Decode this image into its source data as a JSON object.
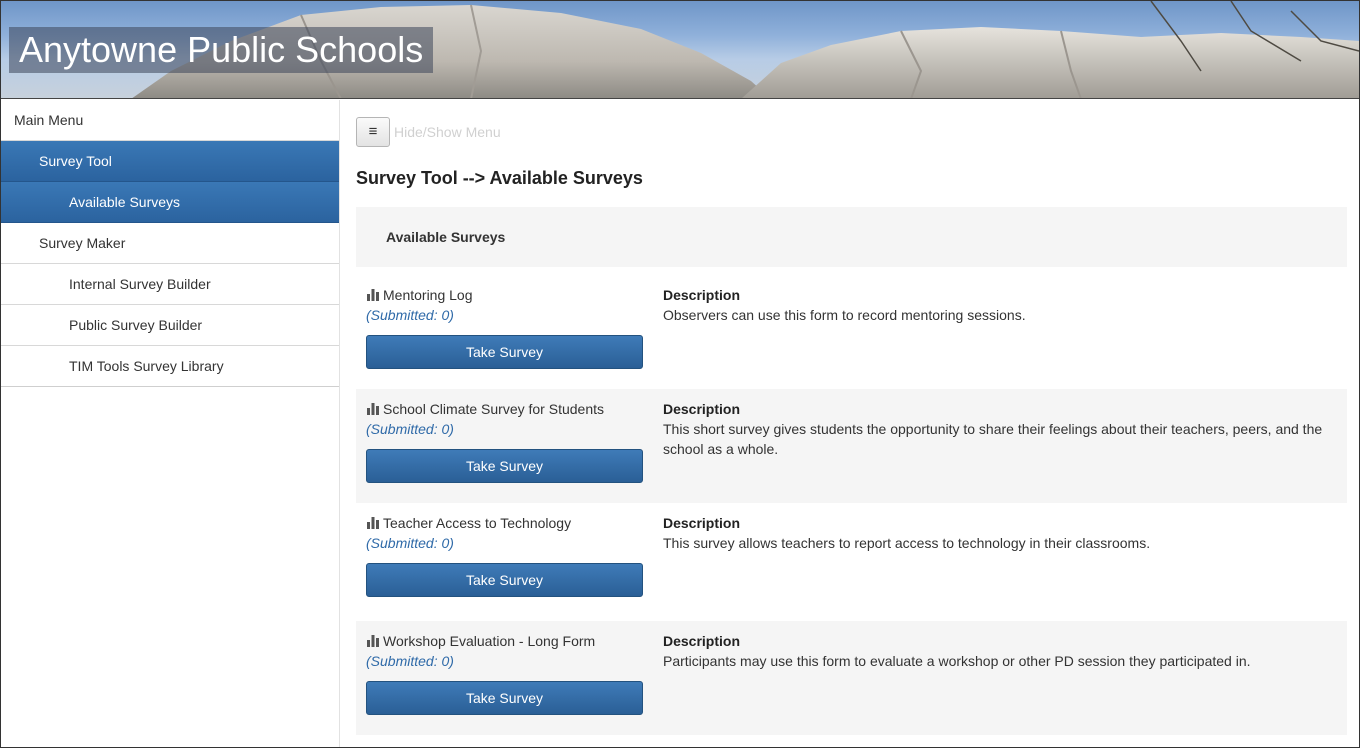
{
  "header": {
    "title": "Anytowne Public Schools"
  },
  "sidebar": {
    "items": [
      {
        "label": "Main Menu"
      },
      {
        "label": "Survey Tool"
      },
      {
        "label": "Available Surveys"
      },
      {
        "label": "Survey Maker"
      },
      {
        "label": "Internal Survey Builder"
      },
      {
        "label": "Public Survey Builder"
      },
      {
        "label": "TIM Tools Survey Library"
      }
    ]
  },
  "toolbar": {
    "toggle_icon": "≡",
    "toggle_label": "Hide/Show Menu"
  },
  "main": {
    "page_title": "Survey Tool --> Available Surveys",
    "panel_title": "Available Surveys",
    "surveys": [
      {
        "name": "Mentoring Log",
        "submitted": "(Submitted: 0)",
        "button": "Take Survey",
        "description_label": "Description",
        "description": "Observers can use this form to record mentoring sessions."
      },
      {
        "name": "School Climate Survey for Students",
        "submitted": "(Submitted: 0)",
        "button": "Take Survey",
        "description_label": "Description",
        "description": "This short survey gives students the opportunity to share their feelings about their teachers, peers, and the school as a whole."
      },
      {
        "name": "Teacher Access to Technology",
        "submitted": "(Submitted: 0)",
        "button": "Take Survey",
        "description_label": "Description",
        "description": "This survey allows teachers to report access to technology in their classrooms."
      },
      {
        "name": "Workshop Evaluation - Long Form",
        "submitted": "(Submitted: 0)",
        "button": "Take Survey",
        "description_label": "Description",
        "description": "Participants may use this form to evaluate a workshop or other PD session they participated in."
      }
    ]
  },
  "colors": {
    "accent": "#2b639f",
    "link": "#2f6aa8",
    "row_alt": "#f5f5f5"
  },
  "icons": {
    "survey": "bar-chart-icon",
    "toggle": "hamburger-icon"
  }
}
